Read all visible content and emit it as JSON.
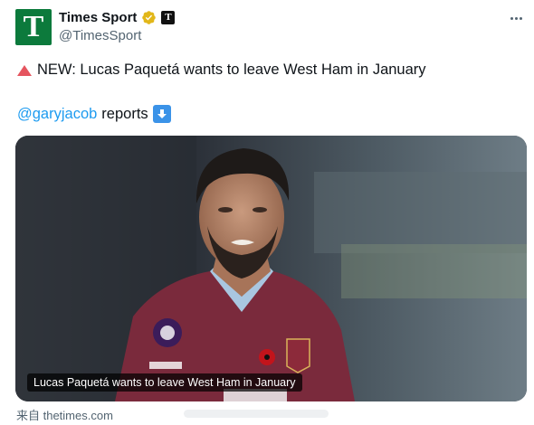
{
  "account": {
    "avatar_letter": "T",
    "display_name": "Times Sport",
    "handle": "@TimesSport",
    "affiliate_badge_letter": "T"
  },
  "icons": {
    "verified": "verified-badge-icon",
    "affiliate": "affiliate-badge-icon",
    "more": "more-options-icon",
    "alert": "red-triangle-icon",
    "arrow": "down-arrow-icon"
  },
  "tweet": {
    "line1": "NEW: Lucas Paquetá wants to leave West Ham in January",
    "mention": "@garyjacob",
    "line2_rest": "reports"
  },
  "card": {
    "caption": "Lucas Paquetá wants to leave West Ham in January",
    "source": "来自 thetimes.com"
  },
  "colors": {
    "avatar_bg": "#0c7a3c",
    "link": "#1d9bf0",
    "secondary_text": "#536471",
    "verified_gold": "#e2b719",
    "alert_red": "#e5555f"
  }
}
